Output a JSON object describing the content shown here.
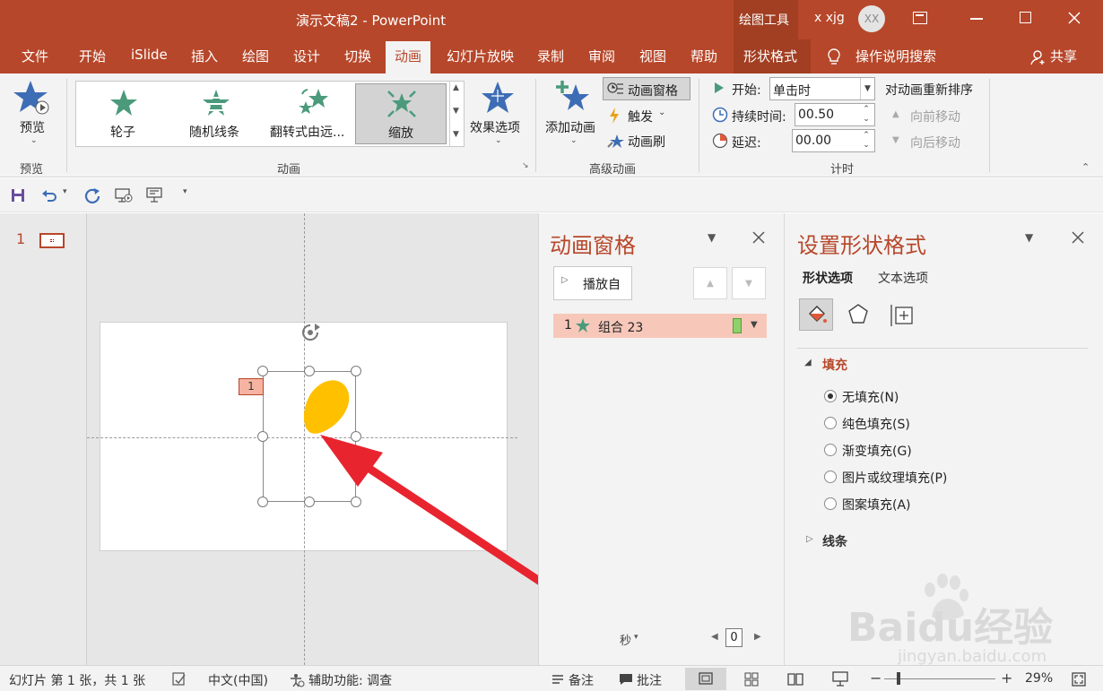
{
  "titlebar": {
    "title": "演示文稿2  -  PowerPoint",
    "context_tool": "绘图工具",
    "user_name": "x xjg",
    "avatar_initials": "XX"
  },
  "tabs": [
    "文件",
    "开始",
    "iSlide",
    "插入",
    "绘图",
    "设计",
    "切换",
    "动画",
    "幻灯片放映",
    "录制",
    "审阅",
    "视图",
    "帮助",
    "形状格式"
  ],
  "active_tab": "动画",
  "tell_me": "操作说明搜索",
  "share": "共享",
  "ribbon": {
    "preview": {
      "button": "预览",
      "group": "预览"
    },
    "animation_gallery": [
      "轮子",
      "随机线条",
      "翻转式由远...",
      "缩放"
    ],
    "selected_animation": "缩放",
    "effect_options": "效果选项",
    "animation_group": "动画",
    "add_animation": "添加动画",
    "animation_pane_btn": "动画窗格",
    "trigger": "触发",
    "animation_painter": "动画刷",
    "advanced_group": "高级动画",
    "start_label": "开始:",
    "start_value": "单击时",
    "duration_label": "持续时间:",
    "duration_value": "00.50",
    "delay_label": "延迟:",
    "delay_value": "00.00",
    "reorder_title": "对动画重新排序",
    "move_earlier": "向前移动",
    "move_later": "向后移动",
    "timing_group": "计时"
  },
  "slides": {
    "number": "1"
  },
  "canvas": {
    "animation_tag": "1",
    "shape_color": "#ffc000",
    "arrow_color": "#e8242f"
  },
  "animation_pane": {
    "title": "动画窗格",
    "play_from": "播放自",
    "item_index": "1",
    "item_name": "组合 23",
    "timeline_unit": "秒",
    "timeline_zoom": "0"
  },
  "format_pane": {
    "title": "设置形状格式",
    "tab_shape": "形状选项",
    "tab_text": "文本选项",
    "fill_section": "填充",
    "fill_options": [
      "无填充(N)",
      "纯色填充(S)",
      "渐变填充(G)",
      "图片或纹理填充(P)",
      "图案填充(A)"
    ],
    "fill_selected": "无填充(N)",
    "line_section": "线条"
  },
  "statusbar": {
    "slide_info": "幻灯片 第 1 张，共 1 张",
    "language": "中文(中国)",
    "accessibility": "辅助功能: 调查",
    "notes": "备注",
    "comments": "批注",
    "zoom": "29%"
  },
  "watermark": {
    "brand": "Baidu经验",
    "url": "jingyan.baidu.com"
  }
}
